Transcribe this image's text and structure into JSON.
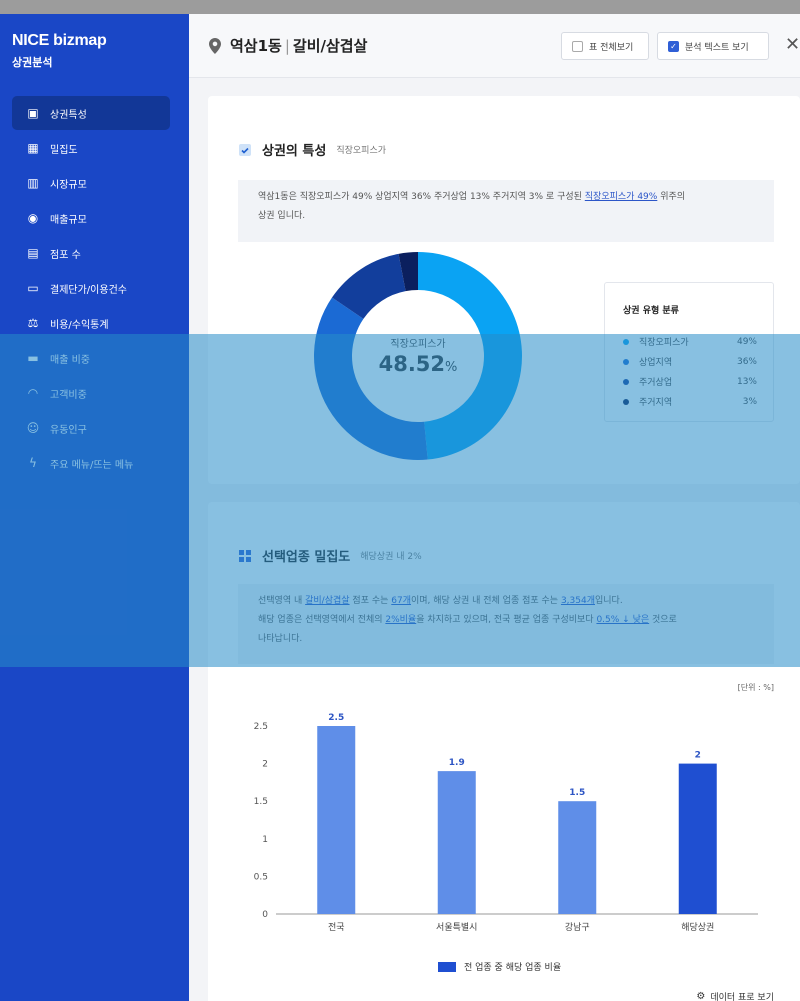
{
  "sidebar": {
    "brand": "NICE bizmap",
    "brand_sub": "상권분석",
    "items": [
      {
        "label": "상권특성",
        "icon": "document-icon",
        "active": true
      },
      {
        "label": "밀집도",
        "icon": "grid-icon",
        "active": false
      },
      {
        "label": "시장규모",
        "icon": "bar-chart-icon",
        "active": false
      },
      {
        "label": "매출규모",
        "icon": "won-coin-icon",
        "active": false
      },
      {
        "label": "점포 수",
        "icon": "store-icon",
        "active": false
      },
      {
        "label": "결제단가/이용건수",
        "icon": "wallet-icon",
        "active": false
      },
      {
        "label": "비용/수익통계",
        "icon": "scale-icon",
        "active": false
      },
      {
        "label": "매출 비중",
        "icon": "card-icon",
        "active": false
      },
      {
        "label": "고객비중",
        "icon": "headset-icon",
        "active": false
      },
      {
        "label": "유동인구",
        "icon": "people-icon",
        "active": false
      },
      {
        "label": "주요 메뉴/뜨는 메뉴",
        "icon": "flash-icon",
        "active": false
      }
    ]
  },
  "header": {
    "location": "역삼1동",
    "category": "갈비/삼겹살",
    "btn_table": "표 전체보기",
    "btn_text": "분석 텍스트 보기",
    "close": "✕"
  },
  "section1": {
    "title": "상권의 특성",
    "subtitle": "직장오피스가",
    "desc_pre": "역삼1동은 직장오피스가 49% 상업지역 36% 주거상업 13% 주거지역 3% 로 구성된 ",
    "desc_link": "직장오피스가 49%",
    "desc_post": " 위주의",
    "desc_line2": "상권 입니다.",
    "center_label": "직장오피스가",
    "center_value": "48.52",
    "center_unit": "%",
    "legend_title": "상권 유형 분류",
    "legend": [
      {
        "name": "직장오피스가",
        "value": "49%",
        "color": "#0aa3f3"
      },
      {
        "name": "상업지역",
        "value": "36%",
        "color": "#1b6ad4"
      },
      {
        "name": "주거상업",
        "value": "13%",
        "color": "#123e9c"
      },
      {
        "name": "주거지역",
        "value": "3%",
        "color": "#0b1f5e"
      }
    ],
    "donut_values": [
      48.52,
      36,
      12.5,
      3
    ]
  },
  "section2": {
    "title": "선택업종 밀집도",
    "subtitle": "해당상권 내 2%",
    "l1_a": "선택영역 내 ",
    "l1_b": "갈비/삼겹살",
    "l1_c": " 점포 수는 ",
    "l1_d": "67개",
    "l1_e": "이며, 해당 상권 내 전체 업종 점포 수는 ",
    "l1_f": "3,354개",
    "l1_g": "입니다.",
    "l2_a": "해당 업종은 선택영역에서 전체의 ",
    "l2_b": "2%비율",
    "l2_c": "을 차지하고 있으며, 전국 평균 업종 구성비보다 ",
    "l2_d": "0.5% ↓ 낮은",
    "l2_e": " 것으로",
    "l3": "나타납니다.",
    "unit_note": "[단위 : %]",
    "legend_label": "전 업종 중 해당 업종 비율",
    "data_link": "데이터 표로 보기"
  },
  "chart_data": {
    "type": "bar",
    "categories": [
      "전국",
      "서울특별시",
      "강남구",
      "해당상권"
    ],
    "values": [
      2.5,
      1.9,
      1.5,
      2
    ],
    "value_labels": [
      "2.5",
      "1.9",
      "1.5",
      "2"
    ],
    "yticks": [
      "0",
      "0.5",
      "1",
      "1.5",
      "2",
      "2.5"
    ],
    "ylim": [
      0,
      2.5
    ],
    "series": [
      {
        "name": "전 업종 중 해당 업종 비율",
        "values": [
          2.5,
          1.9,
          1.5,
          2
        ]
      }
    ],
    "colors": [
      "#5f8ee8",
      "#5f8ee8",
      "#5f8ee8",
      "#1f4fd1"
    ]
  }
}
